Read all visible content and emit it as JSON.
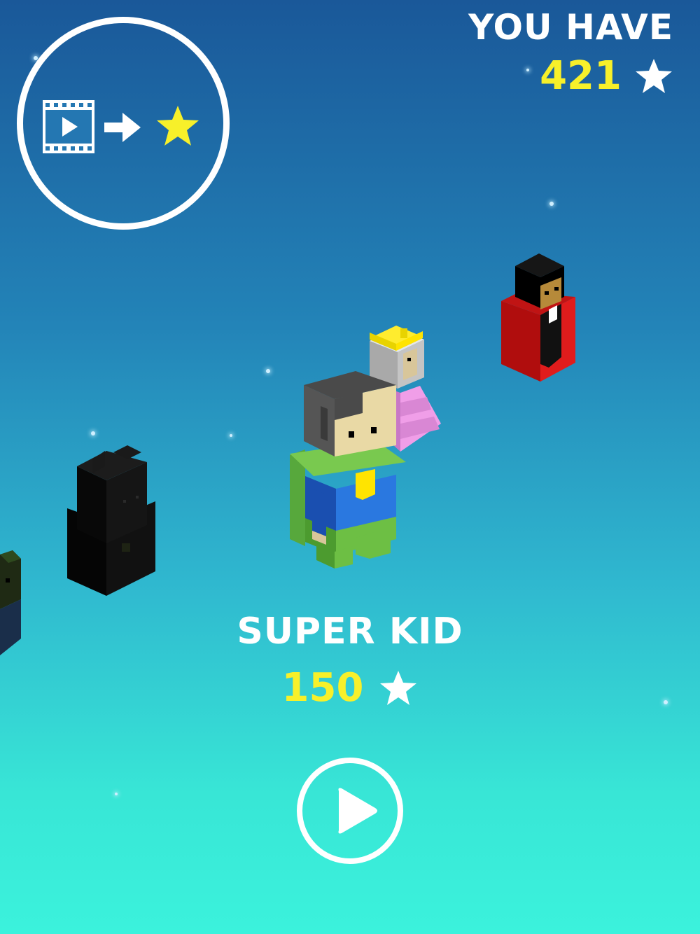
{
  "wallet": {
    "label": "YOU HAVE",
    "count": "421",
    "icon": "star-icon"
  },
  "video_reward": {
    "icons": [
      "film-play-icon",
      "arrow-right-icon",
      "star-icon"
    ],
    "star_color": "#f7f02a"
  },
  "character": {
    "name": "SUPER KID",
    "price": "150",
    "price_icon": "star-icon"
  },
  "controls": {
    "play_icon": "play-icon"
  },
  "carousel": {
    "characters": [
      "super-kid-character",
      "princess-character",
      "vampire-character",
      "bat-character",
      "zombie-character"
    ]
  },
  "colors": {
    "accent_yellow": "#f7f02a",
    "text_white": "#ffffff",
    "bg_top": "#1a5899",
    "bg_bottom": "#3bf2dc"
  }
}
